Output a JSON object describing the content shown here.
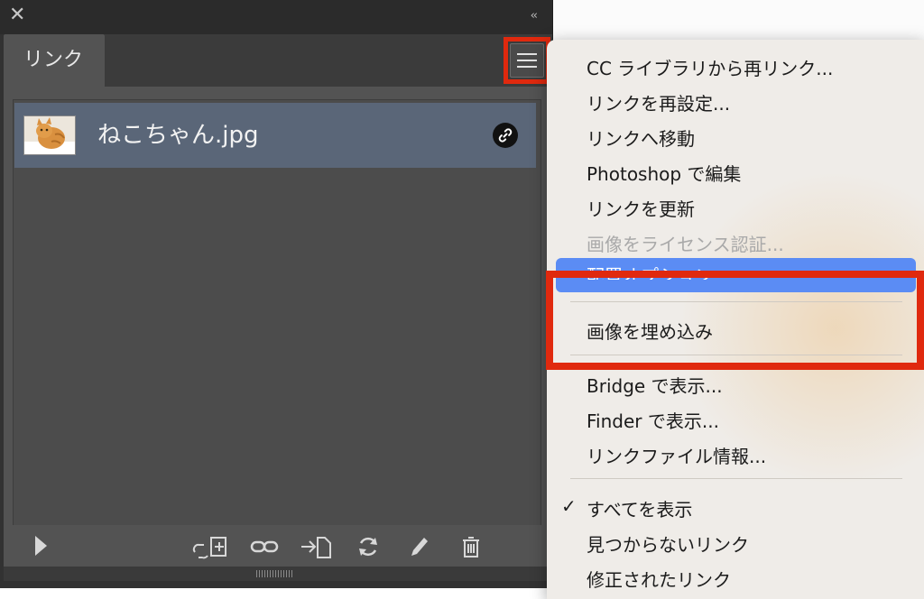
{
  "panel": {
    "tab_label": "リンク",
    "collapse_glyph": "‹‹",
    "close_glyph": "✕",
    "file": {
      "name": "ねこちゃん.jpg"
    }
  },
  "menu": {
    "items": [
      {
        "label": "CC ライブラリから再リンク...",
        "state": "enabled"
      },
      {
        "label": "リンクを再設定...",
        "state": "enabled"
      },
      {
        "label": "リンクへ移動",
        "state": "enabled"
      },
      {
        "label": "Photoshop で編集",
        "state": "enabled"
      },
      {
        "label": "リンクを更新",
        "state": "enabled"
      },
      {
        "label": "画像をライセンス認証...",
        "state": "disabled"
      },
      {
        "label": "配置オプション...",
        "state": "highlighted"
      },
      {
        "label": "画像を埋め込み",
        "state": "enabled"
      },
      {
        "label": "Bridge で表示...",
        "state": "enabled"
      },
      {
        "label": "Finder で表示...",
        "state": "enabled"
      },
      {
        "label": "リンクファイル情報...",
        "state": "enabled"
      },
      {
        "label": "すべてを表示",
        "state": "checked"
      },
      {
        "label": "見つからないリンク",
        "state": "enabled"
      },
      {
        "label": "修正されたリンク",
        "state": "enabled"
      }
    ],
    "check_glyph": "✓"
  },
  "colors": {
    "annotation": "#e0290e",
    "selection": "#5a6678",
    "menu_highlight": "#5b8cf4"
  }
}
